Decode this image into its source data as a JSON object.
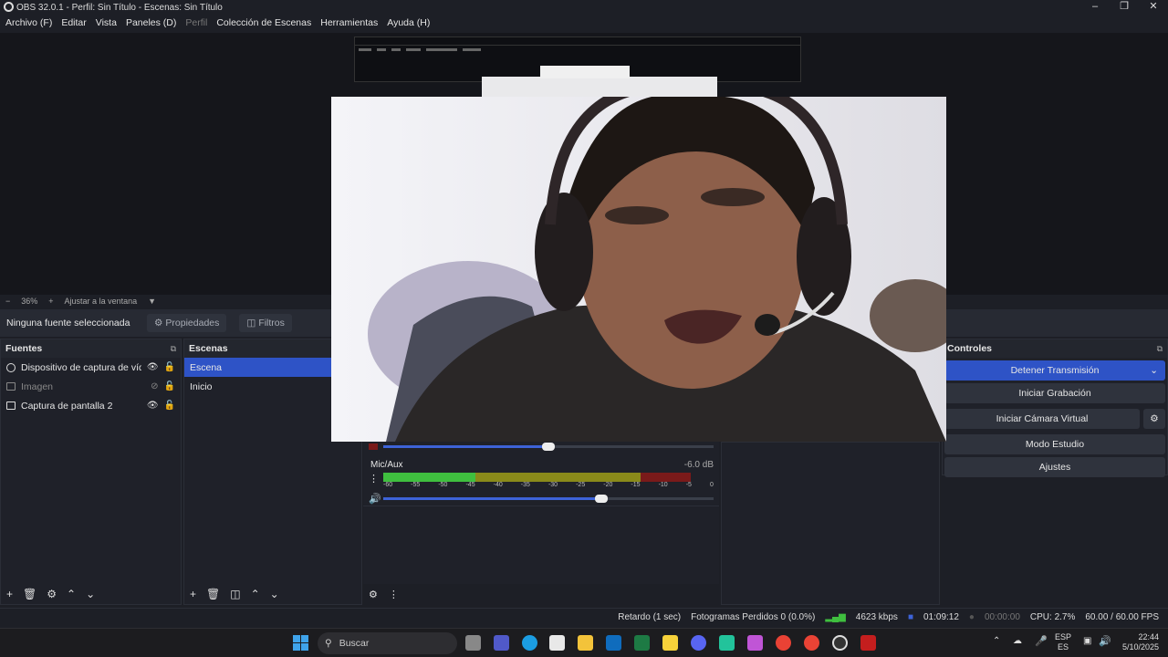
{
  "window": {
    "title": "OBS 32.0.1 - Perfil: Sin Título - Escenas: Sin Título"
  },
  "menu": [
    "Archivo (F)",
    "Editar",
    "Vista",
    "Paneles (D)",
    "Perfil",
    "Colección de Escenas",
    "Herramientas",
    "Ayuda (H)"
  ],
  "zoom": {
    "minus": "−",
    "value": "36%",
    "plus": "+",
    "fit": "Ajustar a la ventana"
  },
  "source_toolbar": {
    "no_source": "Ninguna fuente seleccionada",
    "properties": "Propiedades",
    "filters": "Filtros"
  },
  "fuentes": {
    "title": "Fuentes",
    "items": [
      {
        "label": "Dispositivo de captura de vídeo",
        "icon": "camera-icon"
      },
      {
        "label": "Imagen",
        "icon": "image-icon"
      },
      {
        "label": "Captura de pantalla 2",
        "icon": "monitor-icon"
      }
    ]
  },
  "escenas": {
    "title": "Escenas",
    "items": [
      "Escena",
      "Inicio"
    ]
  },
  "mixer": {
    "mic": {
      "label": "Mic/Aux",
      "db": "-6.0 dB",
      "ticks": [
        "-60",
        "-55",
        "-50",
        "-45",
        "-40",
        "-35",
        "-30",
        "-25",
        "-20",
        "-15",
        "-10",
        "-5",
        "0"
      ]
    },
    "desktop_volume": 0.5,
    "mic_volume": 0.66
  },
  "controles": {
    "title": "Controles",
    "buttons": [
      "Detener Transmisión",
      "Iniciar Grabación",
      "Iniciar Cámara Virtual",
      "Modo Estudio",
      "Ajustes"
    ]
  },
  "status": {
    "delay": "Retardo (1 sec)",
    "dropped": "Fotogramas Perdidos 0 (0.0%)",
    "kbps": "4623 kbps",
    "live_time": "01:09:12",
    "rec_time": "00:00:00",
    "cpu": "CPU: 2.7%",
    "fps": "60.00 / 60.00 FPS"
  },
  "taskbar": {
    "search": "Buscar",
    "lang1": "ESP",
    "lang2": "ES",
    "time": "22:44",
    "date": "5/10/2025"
  },
  "colors": {
    "accent": "#2e53c6",
    "meter_green": "#3fbf3f",
    "meter_yellow": "#8a8a1a",
    "meter_red": "#7a1a1a"
  }
}
